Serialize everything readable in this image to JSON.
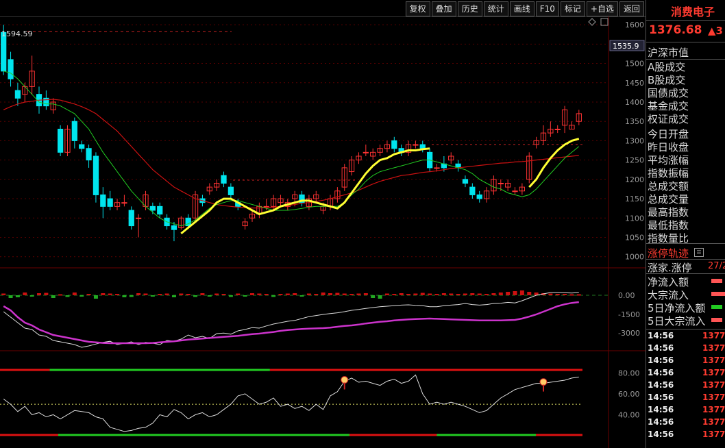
{
  "toolbar": {
    "buttons": [
      "复权",
      "叠加",
      "历史",
      "统计",
      "画线",
      "F10",
      "标记",
      "+自选",
      "返回"
    ]
  },
  "chart_panel": {
    "high_marker": "1594.59",
    "current_tag": "1535.9",
    "price_axis": [
      "1600",
      "1550",
      "1500",
      "1450",
      "1400",
      "1350",
      "1300",
      "1250",
      "1200",
      "1150",
      "1100",
      "1050",
      "1000"
    ],
    "flow_axis": [
      "0.00",
      "-1500",
      "-3000"
    ],
    "osc_axis": [
      "80.00",
      "60.00",
      "40.00"
    ]
  },
  "right_panel": {
    "name": "消费电子",
    "price": "1376.68",
    "change": "▲3",
    "market_value_label": "沪深市值",
    "volume_labels": [
      "A股成交",
      "B股成交",
      "国债成交",
      "基金成交",
      "权证成交"
    ],
    "index_labels": [
      "今日开盘",
      "昨日收盘",
      "平均涨幅",
      "指数振幅",
      "总成交额",
      "总成交量",
      "最高指数",
      "最低指数",
      "指数量比"
    ],
    "limit_label": "涨停轨迹",
    "limit_row": {
      "label": "涨家.涨停",
      "value": "27/2"
    },
    "flow_labels": [
      "净流入额",
      "大宗流入",
      "5日净流入额",
      "5日大宗流入"
    ],
    "ticks": [
      {
        "time": "14:56",
        "price": "1377."
      },
      {
        "time": "14:56",
        "price": "1377."
      },
      {
        "time": "14:56",
        "price": "1377."
      },
      {
        "time": "14:56",
        "price": "1377."
      },
      {
        "time": "14:56",
        "price": "1377."
      },
      {
        "time": "14:56",
        "price": "1377."
      },
      {
        "time": "14:56",
        "price": "1377."
      },
      {
        "time": "14:56",
        "price": "1377."
      },
      {
        "time": "14:56",
        "price": "1377."
      }
    ]
  },
  "colors": {
    "up": "#ff3333",
    "down": "#00e5ee",
    "ma5": "#ffff33",
    "ma20": "#22cc22",
    "ma60": "#cc1111",
    "flow_line": "#cc33cc"
  },
  "chart_data": {
    "type": "candlestick",
    "ylim": [
      980,
      1625
    ],
    "candles": [
      [
        1580,
        1480,
        1600,
        1470
      ],
      [
        1510,
        1460,
        1530,
        1440
      ],
      [
        1430,
        1410,
        1450,
        1390
      ],
      [
        1420,
        1440,
        1450,
        1400
      ],
      [
        1440,
        1480,
        1520,
        1420
      ],
      [
        1420,
        1390,
        1440,
        1370
      ],
      [
        1410,
        1390,
        1430,
        1380
      ],
      [
        1380,
        1400,
        1410,
        1370
      ],
      [
        1330,
        1270,
        1340,
        1260
      ],
      [
        1270,
        1330,
        1340,
        1260
      ],
      [
        1350,
        1300,
        1360,
        1280
      ],
      [
        1290,
        1280,
        1300,
        1270
      ],
      [
        1280,
        1250,
        1290,
        1230
      ],
      [
        1260,
        1160,
        1270,
        1140
      ],
      [
        1160,
        1130,
        1180,
        1100
      ],
      [
        1150,
        1130,
        1170,
        1120
      ],
      [
        1130,
        1140,
        1150,
        1120
      ],
      [
        1140,
        1140,
        1160,
        1130
      ],
      [
        1120,
        1080,
        1130,
        1070
      ],
      [
        1100,
        1100,
        1110,
        1050
      ],
      [
        1130,
        1160,
        1170,
        1120
      ],
      [
        1130,
        1120,
        1140,
        1110
      ],
      [
        1130,
        1110,
        1140,
        1100
      ],
      [
        1100,
        1080,
        1110,
        1070
      ],
      [
        1080,
        1070,
        1090,
        1040
      ],
      [
        1075,
        1100,
        1105,
        1070
      ],
      [
        1100,
        1080,
        1110,
        1075
      ],
      [
        1100,
        1160,
        1170,
        1090
      ],
      [
        1150,
        1140,
        1160,
        1130
      ],
      [
        1170,
        1180,
        1190,
        1160
      ],
      [
        1180,
        1190,
        1200,
        1170
      ],
      [
        1210,
        1190,
        1220,
        1180
      ],
      [
        1180,
        1160,
        1190,
        1150
      ],
      [
        1140,
        1130,
        1150,
        1120
      ],
      [
        1080,
        1090,
        1100,
        1070
      ],
      [
        1100,
        1110,
        1120,
        1090
      ],
      [
        1110,
        1130,
        1140,
        1100
      ],
      [
        1130,
        1130,
        1150,
        1120
      ],
      [
        1130,
        1150,
        1160,
        1120
      ],
      [
        1140,
        1150,
        1160,
        1130
      ],
      [
        1130,
        1140,
        1150,
        1120
      ],
      [
        1150,
        1160,
        1170,
        1130
      ],
      [
        1160,
        1140,
        1170,
        1130
      ],
      [
        1130,
        1150,
        1160,
        1120
      ],
      [
        1150,
        1160,
        1170,
        1140
      ],
      [
        1120,
        1130,
        1140,
        1110
      ],
      [
        1130,
        1150,
        1160,
        1120
      ],
      [
        1150,
        1170,
        1180,
        1140
      ],
      [
        1180,
        1230,
        1240,
        1170
      ],
      [
        1220,
        1250,
        1260,
        1210
      ],
      [
        1250,
        1260,
        1270,
        1240
      ],
      [
        1270,
        1270,
        1290,
        1260
      ],
      [
        1260,
        1270,
        1280,
        1250
      ],
      [
        1270,
        1280,
        1290,
        1260
      ],
      [
        1280,
        1290,
        1300,
        1270
      ],
      [
        1300,
        1280,
        1310,
        1270
      ],
      [
        1280,
        1270,
        1290,
        1260
      ],
      [
        1270,
        1290,
        1300,
        1260
      ],
      [
        1290,
        1290,
        1300,
        1280
      ],
      [
        1290,
        1280,
        1300,
        1270
      ],
      [
        1270,
        1230,
        1280,
        1220
      ],
      [
        1230,
        1230,
        1240,
        1220
      ],
      [
        1240,
        1230,
        1260,
        1220
      ],
      [
        1250,
        1260,
        1270,
        1240
      ],
      [
        1240,
        1230,
        1250,
        1220
      ],
      [
        1200,
        1190,
        1210,
        1180
      ],
      [
        1180,
        1160,
        1190,
        1150
      ],
      [
        1160,
        1150,
        1170,
        1140
      ],
      [
        1150,
        1170,
        1180,
        1140
      ],
      [
        1170,
        1200,
        1210,
        1160
      ],
      [
        1190,
        1190,
        1200,
        1170
      ],
      [
        1180,
        1190,
        1200,
        1170
      ],
      [
        1170,
        1170,
        1180,
        1160
      ],
      [
        1170,
        1180,
        1190,
        1160
      ],
      [
        1200,
        1260,
        1270,
        1190
      ],
      [
        1290,
        1300,
        1310,
        1280
      ],
      [
        1300,
        1320,
        1340,
        1290
      ],
      [
        1320,
        1330,
        1350,
        1310
      ],
      [
        1330,
        1330,
        1340,
        1320
      ],
      [
        1340,
        1380,
        1390,
        1320
      ],
      [
        1330,
        1340,
        1350,
        1330
      ],
      [
        1350,
        1370,
        1380,
        1340
      ]
    ],
    "ma5": [
      null,
      null,
      null,
      null,
      null,
      null,
      null,
      null,
      null,
      null,
      null,
      null,
      null,
      null,
      null,
      null,
      null,
      null,
      null,
      null,
      null,
      null,
      null,
      null,
      null,
      1060,
      1075,
      1090,
      1105,
      1120,
      1140,
      1150,
      1150,
      1140,
      1130,
      1120,
      1110,
      1115,
      1120,
      1130,
      1135,
      1140,
      1145,
      1145,
      1140,
      1135,
      1130,
      1125,
      1140,
      1165,
      1190,
      1215,
      1235,
      1250,
      1255,
      1265,
      1270,
      1275,
      1275,
      1278,
      1280,
      null,
      null,
      null,
      null,
      null,
      null,
      null,
      null,
      null,
      null,
      null,
      null,
      null,
      1180,
      1200,
      1230,
      1255,
      1275,
      1290,
      1300,
      1305
    ],
    "ma20": [
      1480,
      1475,
      1460,
      1440,
      1420,
      1400,
      1395,
      1395,
      1390,
      1380,
      1370,
      1350,
      1330,
      1300,
      1270,
      1245,
      1220,
      1195,
      1170,
      1150,
      1130,
      1115,
      1100,
      1090,
      1085,
      1080,
      1085,
      1095,
      1110,
      1125,
      1135,
      1140,
      1145,
      1145,
      1140,
      1135,
      1130,
      1125,
      1120,
      1120,
      1120,
      1122,
      1125,
      1128,
      1130,
      1130,
      1130,
      1130,
      1140,
      1160,
      1175,
      1195,
      1210,
      1220,
      1225,
      1230,
      1235,
      1240,
      1245,
      1250,
      1250,
      1245,
      1240,
      1235,
      1230,
      1225,
      1215,
      1200,
      1190,
      1180,
      1175,
      1165,
      1160,
      1155,
      1160,
      1175,
      1195,
      1215,
      1235,
      1255,
      1270,
      1285
    ],
    "ma60": [
      1380,
      1388,
      1395,
      1400,
      1402,
      1405,
      1406,
      1407,
      1405,
      1400,
      1395,
      1388,
      1380,
      1370,
      1355,
      1340,
      1325,
      1305,
      1285,
      1265,
      1245,
      1225,
      1210,
      1195,
      1180,
      1170,
      1160,
      1150,
      1145,
      1140,
      1135,
      1132,
      1130,
      1128,
      1127,
      1126,
      1126,
      1127,
      1128,
      1130,
      1132,
      1135,
      1138,
      1140,
      1143,
      1146,
      1150,
      1155,
      1160,
      1165,
      1172,
      1180,
      1188,
      1195,
      1200,
      1205,
      1210,
      1212,
      1215,
      1218,
      1220,
      1222,
      1225,
      1228,
      1230,
      1232,
      1234,
      1236,
      1238,
      1240,
      1242,
      1243,
      1245,
      1246,
      1248,
      1250,
      1252,
      1254,
      1256,
      1258,
      1260,
      1262
    ],
    "flow_line": [
      40,
      55,
      80,
      100,
      110,
      125,
      135,
      145,
      150,
      155,
      160,
      165,
      170,
      172,
      174,
      175,
      175,
      175,
      175,
      175,
      175,
      174,
      172,
      170,
      168,
      165,
      162,
      160,
      158,
      156,
      154,
      152,
      150,
      148,
      145,
      142,
      140,
      137,
      134,
      130,
      127,
      125,
      123,
      122,
      121,
      120,
      118,
      115,
      112,
      110,
      107,
      103,
      100,
      97,
      95,
      92,
      90,
      88,
      87,
      86,
      85,
      86,
      87,
      88,
      89,
      90,
      91,
      92,
      92,
      92,
      92,
      91,
      90,
      85,
      78,
      70,
      60,
      50,
      40,
      33,
      28,
      25
    ],
    "flow_white": [
      60,
      80,
      100,
      120,
      125,
      145,
      150,
      165,
      170,
      175,
      180,
      190,
      185,
      178,
      172,
      168,
      180,
      175,
      170,
      180,
      172,
      175,
      180,
      165,
      168,
      160,
      145,
      155,
      150,
      158,
      140,
      138,
      142,
      130,
      125,
      118,
      120,
      112,
      105,
      100,
      95,
      92,
      85,
      78,
      74,
      70,
      67,
      64,
      60,
      55,
      52,
      48,
      45,
      42,
      40,
      38,
      36,
      35,
      37,
      38,
      42,
      42,
      38,
      36,
      34,
      30,
      34,
      36,
      34,
      30,
      29,
      26,
      28,
      20,
      10,
      0,
      -5,
      -10,
      -10,
      -9,
      -8,
      -10
    ],
    "flow_bars": [
      5,
      -8,
      -6,
      8,
      -4,
      6,
      7,
      -8,
      3,
      -5,
      8,
      -4,
      4,
      -10,
      6,
      5,
      4,
      -6,
      -5,
      6,
      5,
      -4,
      4,
      5,
      -6,
      5,
      4,
      -5,
      6,
      -4,
      5,
      4,
      -5,
      5,
      -4,
      6,
      5,
      4,
      -5,
      4,
      5,
      6,
      -4,
      5,
      4,
      8,
      6,
      7,
      5,
      4,
      5,
      6,
      -8,
      -10,
      5,
      4,
      6,
      4,
      5,
      7,
      5,
      4,
      6,
      5,
      4,
      5,
      6,
      5,
      4,
      6,
      8,
      10,
      12,
      14,
      10,
      8,
      6,
      5,
      4,
      4,
      3,
      3
    ],
    "osc_line": [
      55,
      50,
      43,
      48,
      40,
      42,
      38,
      40,
      36,
      40,
      44,
      43,
      42,
      38,
      36,
      28,
      26,
      24,
      25,
      27,
      28,
      32,
      40,
      38,
      45,
      42,
      36,
      40,
      42,
      38,
      40,
      45,
      50,
      58,
      60,
      55,
      50,
      52,
      56,
      48,
      50,
      46,
      48,
      44,
      50,
      45,
      58,
      62,
      72,
      75,
      71,
      72,
      70,
      68,
      72,
      74,
      70,
      72,
      78,
      60,
      50,
      52,
      50,
      52,
      50,
      48,
      45,
      42,
      44,
      50,
      56,
      60,
      64,
      66,
      68,
      70,
      70,
      71,
      72,
      73,
      75,
      76
    ],
    "osc_top_segments": [
      [
        "red",
        0,
        7
      ],
      [
        "green",
        7,
        38
      ],
      [
        "red",
        38,
        82
      ]
    ],
    "osc_bottom_segments": [
      [
        "red",
        0,
        10
      ],
      [
        "green",
        10,
        60
      ],
      [
        "red",
        60,
        75
      ],
      [
        "green",
        75,
        92
      ],
      [
        "red",
        92,
        100
      ]
    ],
    "signals": [
      48,
      76
    ]
  }
}
